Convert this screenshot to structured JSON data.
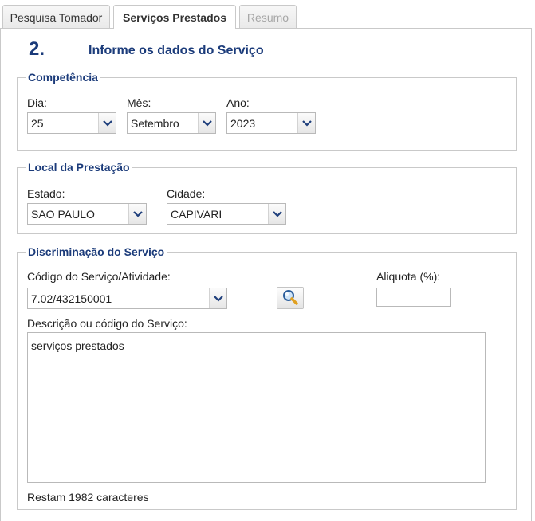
{
  "tabs": [
    {
      "label": "Pesquisa Tomador",
      "state": "normal"
    },
    {
      "label": "Serviços Prestados",
      "state": "active"
    },
    {
      "label": "Resumo",
      "state": "disabled"
    }
  ],
  "step": {
    "number": "2.",
    "title": "Informe os dados do Serviço"
  },
  "competencia": {
    "legend": "Competência",
    "dia": {
      "label": "Dia:",
      "value": "25"
    },
    "mes": {
      "label": "Mês:",
      "value": "Setembro"
    },
    "ano": {
      "label": "Ano:",
      "value": "2023"
    }
  },
  "local": {
    "legend": "Local da Prestação",
    "estado": {
      "label": "Estado:",
      "value": "SAO PAULO"
    },
    "cidade": {
      "label": "Cidade:",
      "value": "CAPIVARI"
    }
  },
  "discriminacao": {
    "legend": "Discriminação do Serviço",
    "codigo": {
      "label": "Código do Serviço/Atividade:",
      "value": "7.02/432150001"
    },
    "aliquota": {
      "label": "Aliquota (%):",
      "value": ""
    },
    "descricao": {
      "label": "Descrição ou código do Serviço:",
      "value": "serviços prestados"
    },
    "counter": "Restam 1982 caracteres"
  },
  "icons": {
    "search": "magnifier-icon",
    "dropdown": "chevron-down-icon"
  },
  "colors": {
    "heading": "#1b3b7a",
    "border": "#c9c9c9",
    "arrow": "#1f3f7c"
  }
}
